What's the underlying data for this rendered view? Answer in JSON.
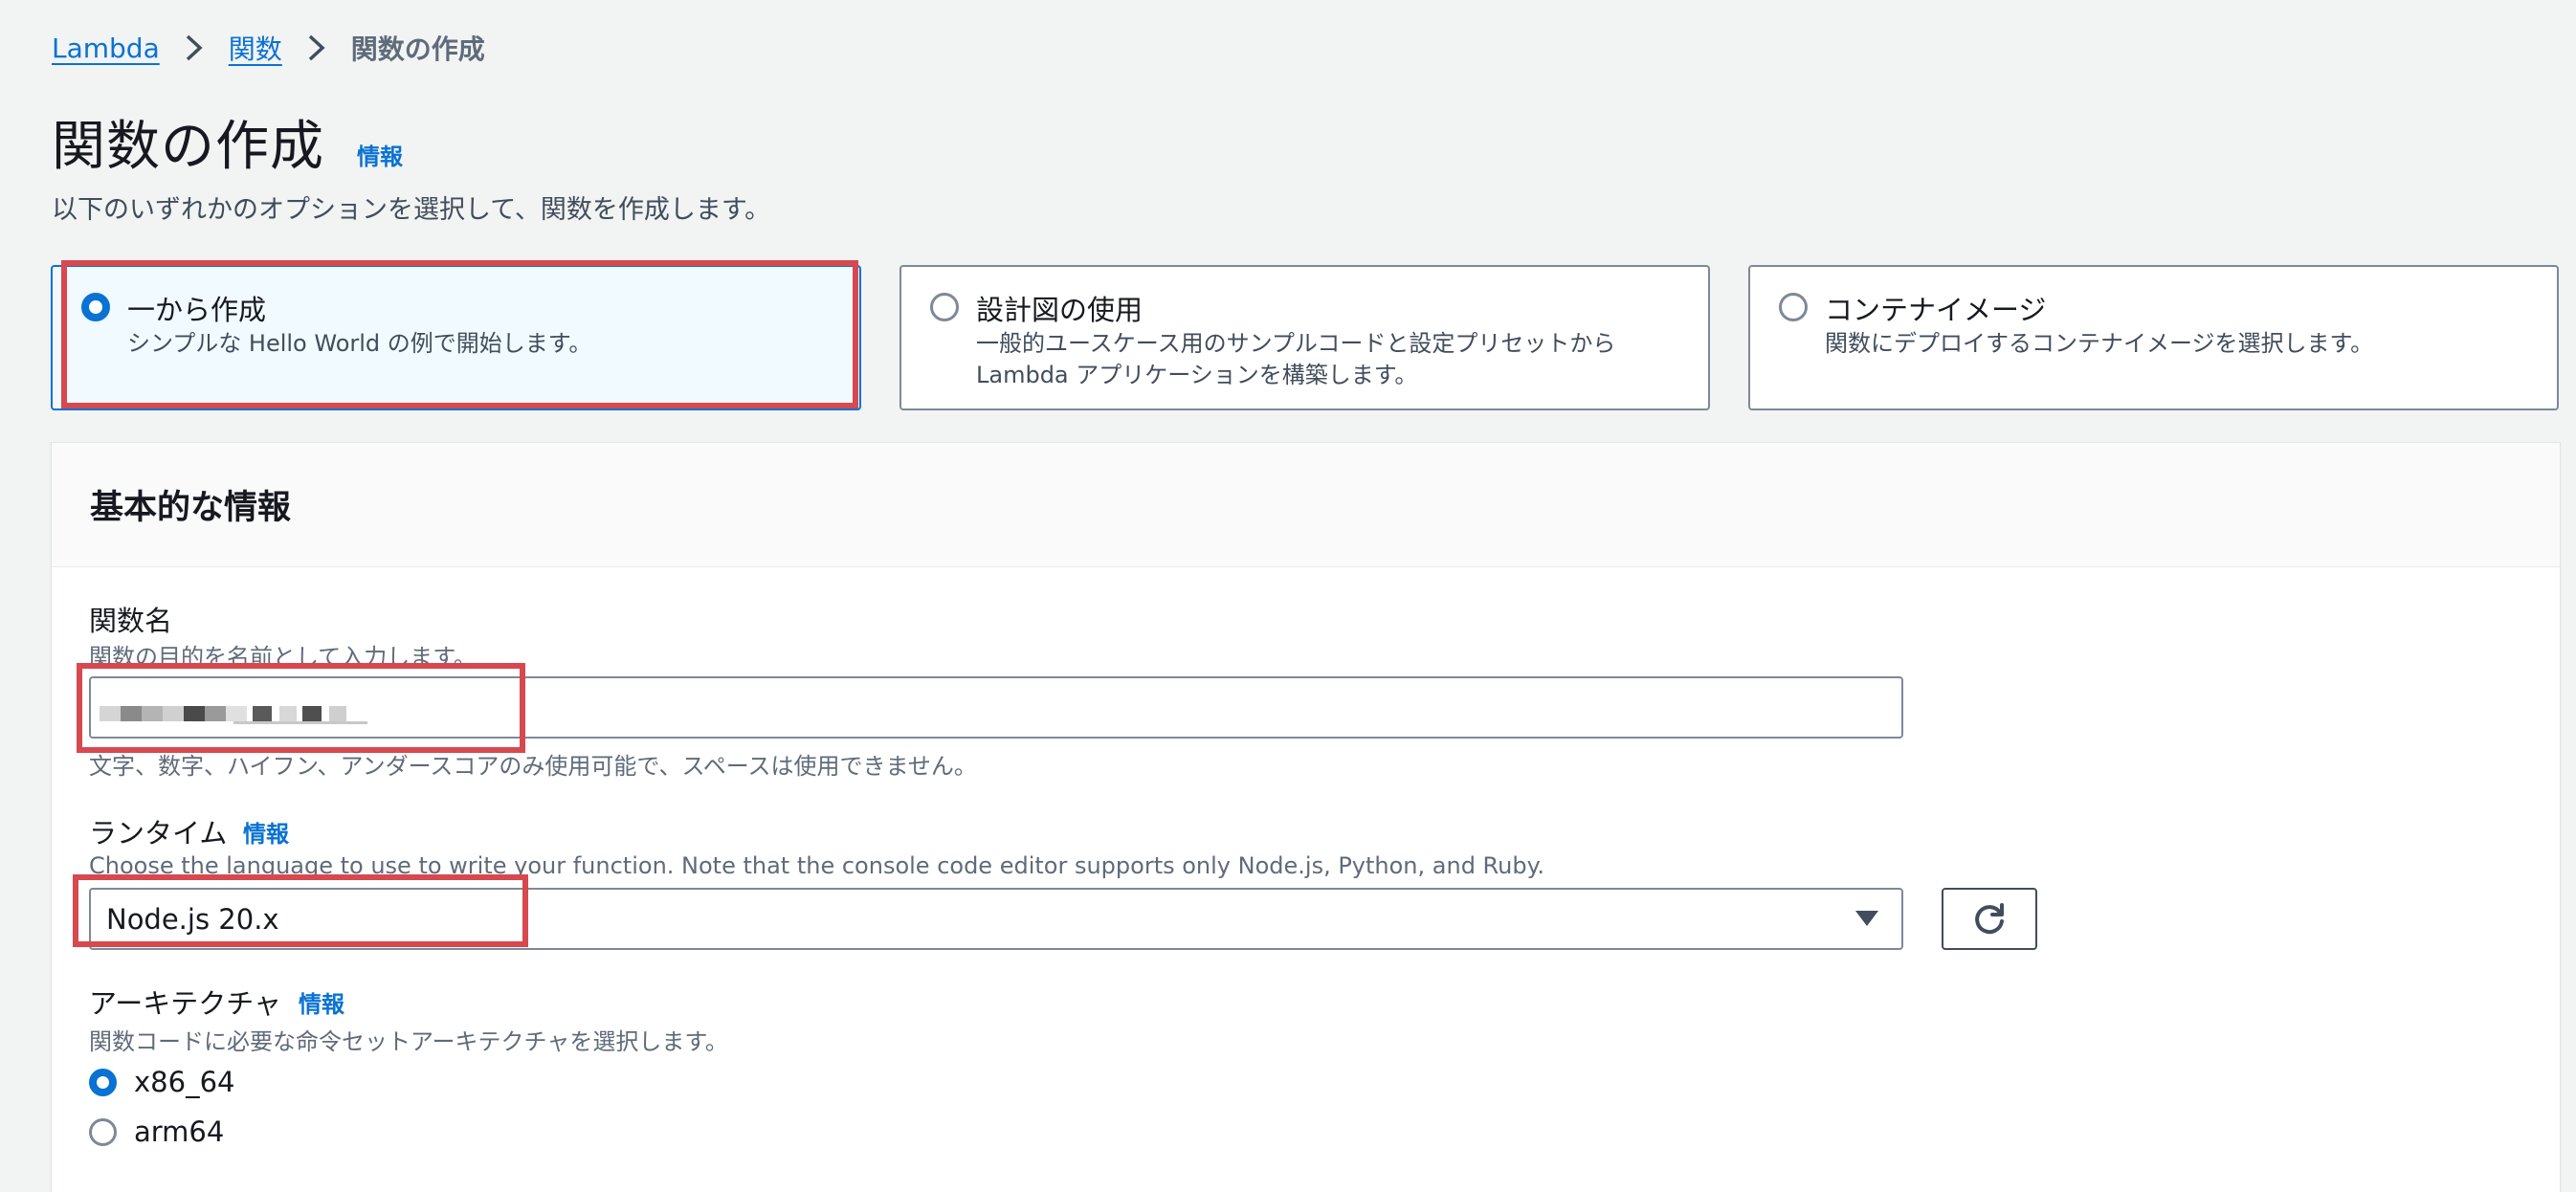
{
  "breadcrumb": {
    "lambda": "Lambda",
    "functions": "関数",
    "current": "関数の作成"
  },
  "page": {
    "title": "関数の作成",
    "info": "情報",
    "subtitle": "以下のいずれかのオプションを選択して、関数を作成します。"
  },
  "options": {
    "scratch": {
      "title": "一から作成",
      "desc": "シンプルな Hello World の例で開始します。"
    },
    "blueprint": {
      "title": "設計図の使用",
      "desc1": "一般的ユースケース用のサンプルコードと設定プリセットから",
      "desc2": "Lambda アプリケーションを構築します。"
    },
    "container": {
      "title": "コンテナイメージ",
      "desc": "関数にデプロイするコンテナイメージを選択します。"
    }
  },
  "basic": {
    "header": "基本的な情報",
    "function_name": {
      "label": "関数名",
      "description": "関数の目的を名前として入力します。",
      "constraint": "文字、数字、ハイフン、アンダースコアのみ使用可能で、スペースは使用できません。"
    },
    "runtime": {
      "label": "ランタイム",
      "info": "情報",
      "description": "Choose the language to use to write your function. Note that the console code editor supports only Node.js, Python, and Ruby.",
      "value": "Node.js 20.x"
    },
    "architecture": {
      "label": "アーキテクチャ",
      "info": "情報",
      "description": "関数コードに必要な命令セットアーキテクチャを選択します。",
      "options": [
        "x86_64",
        "arm64"
      ],
      "selected": "x86_64"
    }
  },
  "colors": {
    "accent": "#0972d3",
    "highlight": "#d7484f"
  }
}
